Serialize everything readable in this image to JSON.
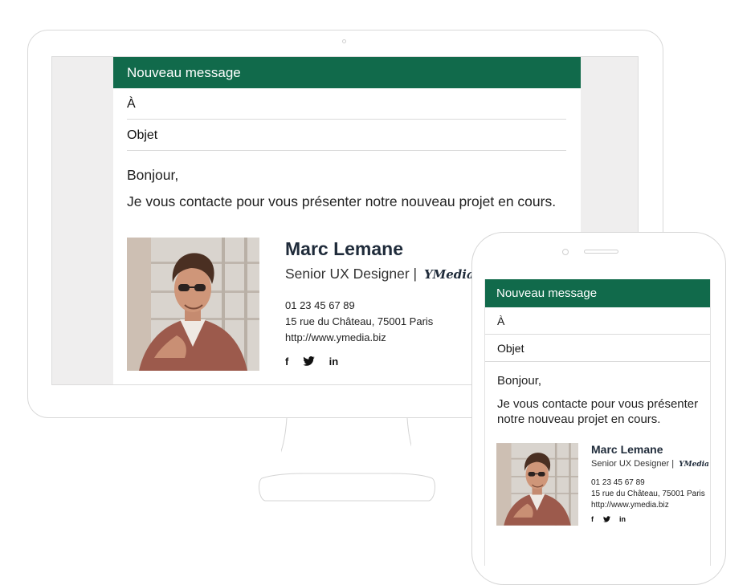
{
  "compose": {
    "title": "Nouveau message",
    "to_label": "À",
    "subject_label": "Objet",
    "greeting": "Bonjour,",
    "body": "Je vous contacte pour vous présenter notre nouveau projet en cours.",
    "body_mobile_line1": "Je vous contacte pour vous présenter",
    "body_mobile_line2": "notre nouveau projet en cours."
  },
  "signature": {
    "name": "Marc Lemane",
    "role": "Senior UX Designer",
    "separator": "|",
    "brand": "YMedia",
    "phone": "01 23 45 67 89",
    "address": "15 rue du Château, 75001 Paris",
    "website": "http://www.ymedia.biz",
    "social": {
      "facebook": "f",
      "twitter": "🐦",
      "linkedin": "in"
    }
  },
  "colors": {
    "header": "#116a4b",
    "name": "#1f2b3a"
  }
}
